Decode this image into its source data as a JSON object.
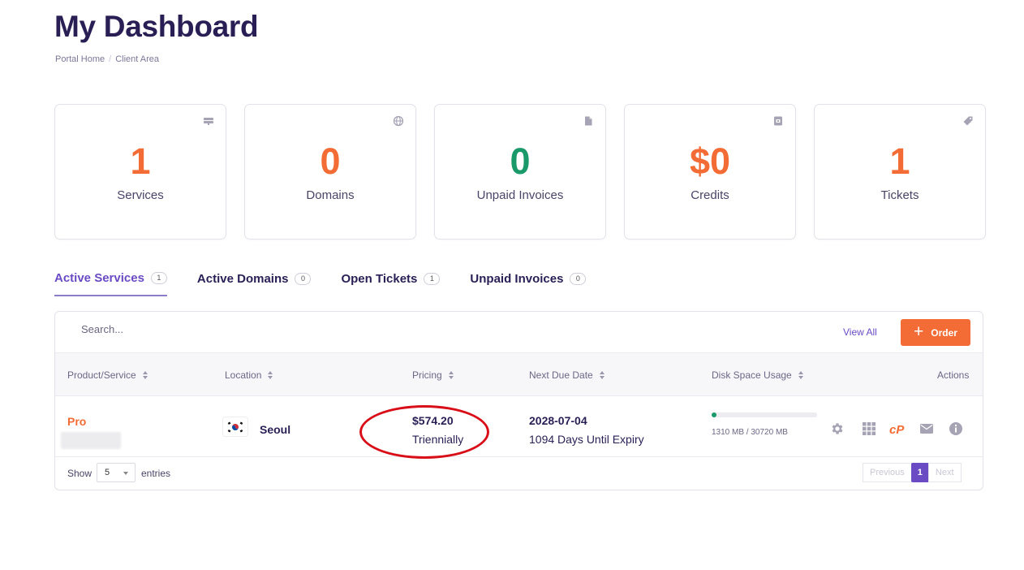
{
  "page": {
    "title": "My Dashboard",
    "breadcrumb": [
      "Portal Home",
      "Client Area"
    ]
  },
  "stats": [
    {
      "value": "1",
      "label": "Services",
      "icon": "server-icon",
      "color": "#f36c35"
    },
    {
      "value": "0",
      "label": "Domains",
      "icon": "globe-icon",
      "color": "#f36c35"
    },
    {
      "value": "0",
      "label": "Unpaid Invoices",
      "icon": "document-icon",
      "color": "#1a9a6a"
    },
    {
      "value": "$0",
      "label": "Credits",
      "icon": "wallet-icon",
      "color": "#f36c35"
    },
    {
      "value": "1",
      "label": "Tickets",
      "icon": "tag-icon",
      "color": "#f36c35"
    }
  ],
  "tabs": [
    {
      "label": "Active Services",
      "count": "1",
      "active": true
    },
    {
      "label": "Active Domains",
      "count": "0",
      "active": false
    },
    {
      "label": "Open Tickets",
      "count": "1",
      "active": false
    },
    {
      "label": "Unpaid Invoices",
      "count": "0",
      "active": false
    }
  ],
  "toolbar": {
    "search_placeholder": "Search...",
    "view_all": "View All",
    "order_label": "Order"
  },
  "table": {
    "columns": [
      "Product/Service",
      "Location",
      "Pricing",
      "Next Due Date",
      "Disk Space Usage",
      "Actions"
    ],
    "rows": [
      {
        "product": "Pro",
        "location": "Seoul",
        "price": "$574.20",
        "cycle": "Triennially",
        "due_date": "2028-07-04",
        "expiry": "1094 Days Until Expiry",
        "disk_used_fraction": 0.0427,
        "disk_text": "1310 MB / 30720 MB",
        "actions": [
          "gear-icon",
          "grid-icon",
          "cpanel-icon",
          "mail-icon",
          "info-icon"
        ]
      }
    ]
  },
  "footer": {
    "show_label": "Show",
    "entries_value": "5",
    "entries_label": "entries",
    "prev_label": "Previous",
    "page_current": "1",
    "next_label": "Next"
  },
  "colors": {
    "accent": "#f36c35",
    "brand": "#6a4bc4",
    "title": "#2a1f55",
    "success": "#1a9a6a",
    "annotation": "#d80f19"
  }
}
